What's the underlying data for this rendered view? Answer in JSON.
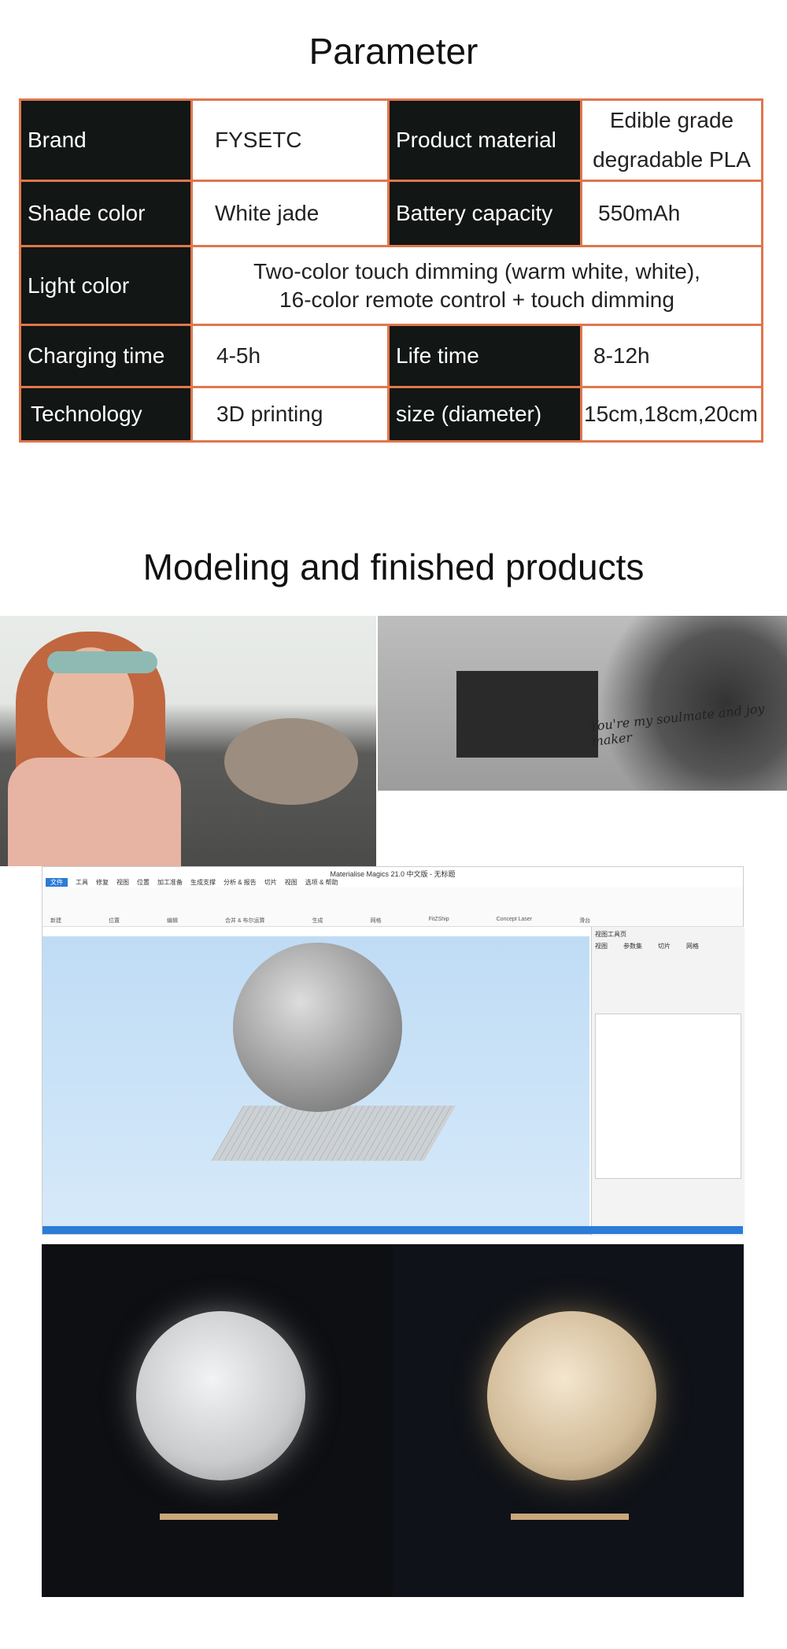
{
  "section1_title": "Parameter",
  "params": [
    [
      "Brand",
      "FYSETC",
      "Product material",
      "Edible grade degradable PLA"
    ],
    [
      "Shade color",
      "White jade",
      "Battery capacity",
      "550mAh"
    ],
    [
      "Light color",
      "Two-color touch dimming (warm white, white), 16-color remote control + touch dimming"
    ],
    [
      "Charging time",
      "4-5h",
      "Life time",
      "8-12h"
    ],
    [
      "Technology",
      "3D printing",
      "size (diameter)",
      "15cm,18cm,20cm"
    ]
  ],
  "section2_title": "Modeling and finished products",
  "photo_caption": "You're my soulmate and joy maker",
  "software": {
    "window_title": "Materialise Magics 21.0 中文版 - 无标题",
    "tabs": [
      "文件",
      "工具",
      "修复",
      "视图",
      "位置",
      "加工准备",
      "生成支撑",
      "分析 & 报告",
      "切片",
      "视图",
      "选项 & 帮助"
    ],
    "ribbon_groups": [
      "新建",
      "位置",
      "编辑",
      "合并 & 布尔运算",
      "生成",
      "网格",
      "FitZShip",
      "Concept Laser",
      "滑台"
    ],
    "panel_tabs": [
      "视图",
      "参数集",
      "切片",
      "网格"
    ],
    "panel_title": "视图工具页"
  },
  "colors": {
    "border": "#e0764e",
    "key_bg": "#121614"
  }
}
